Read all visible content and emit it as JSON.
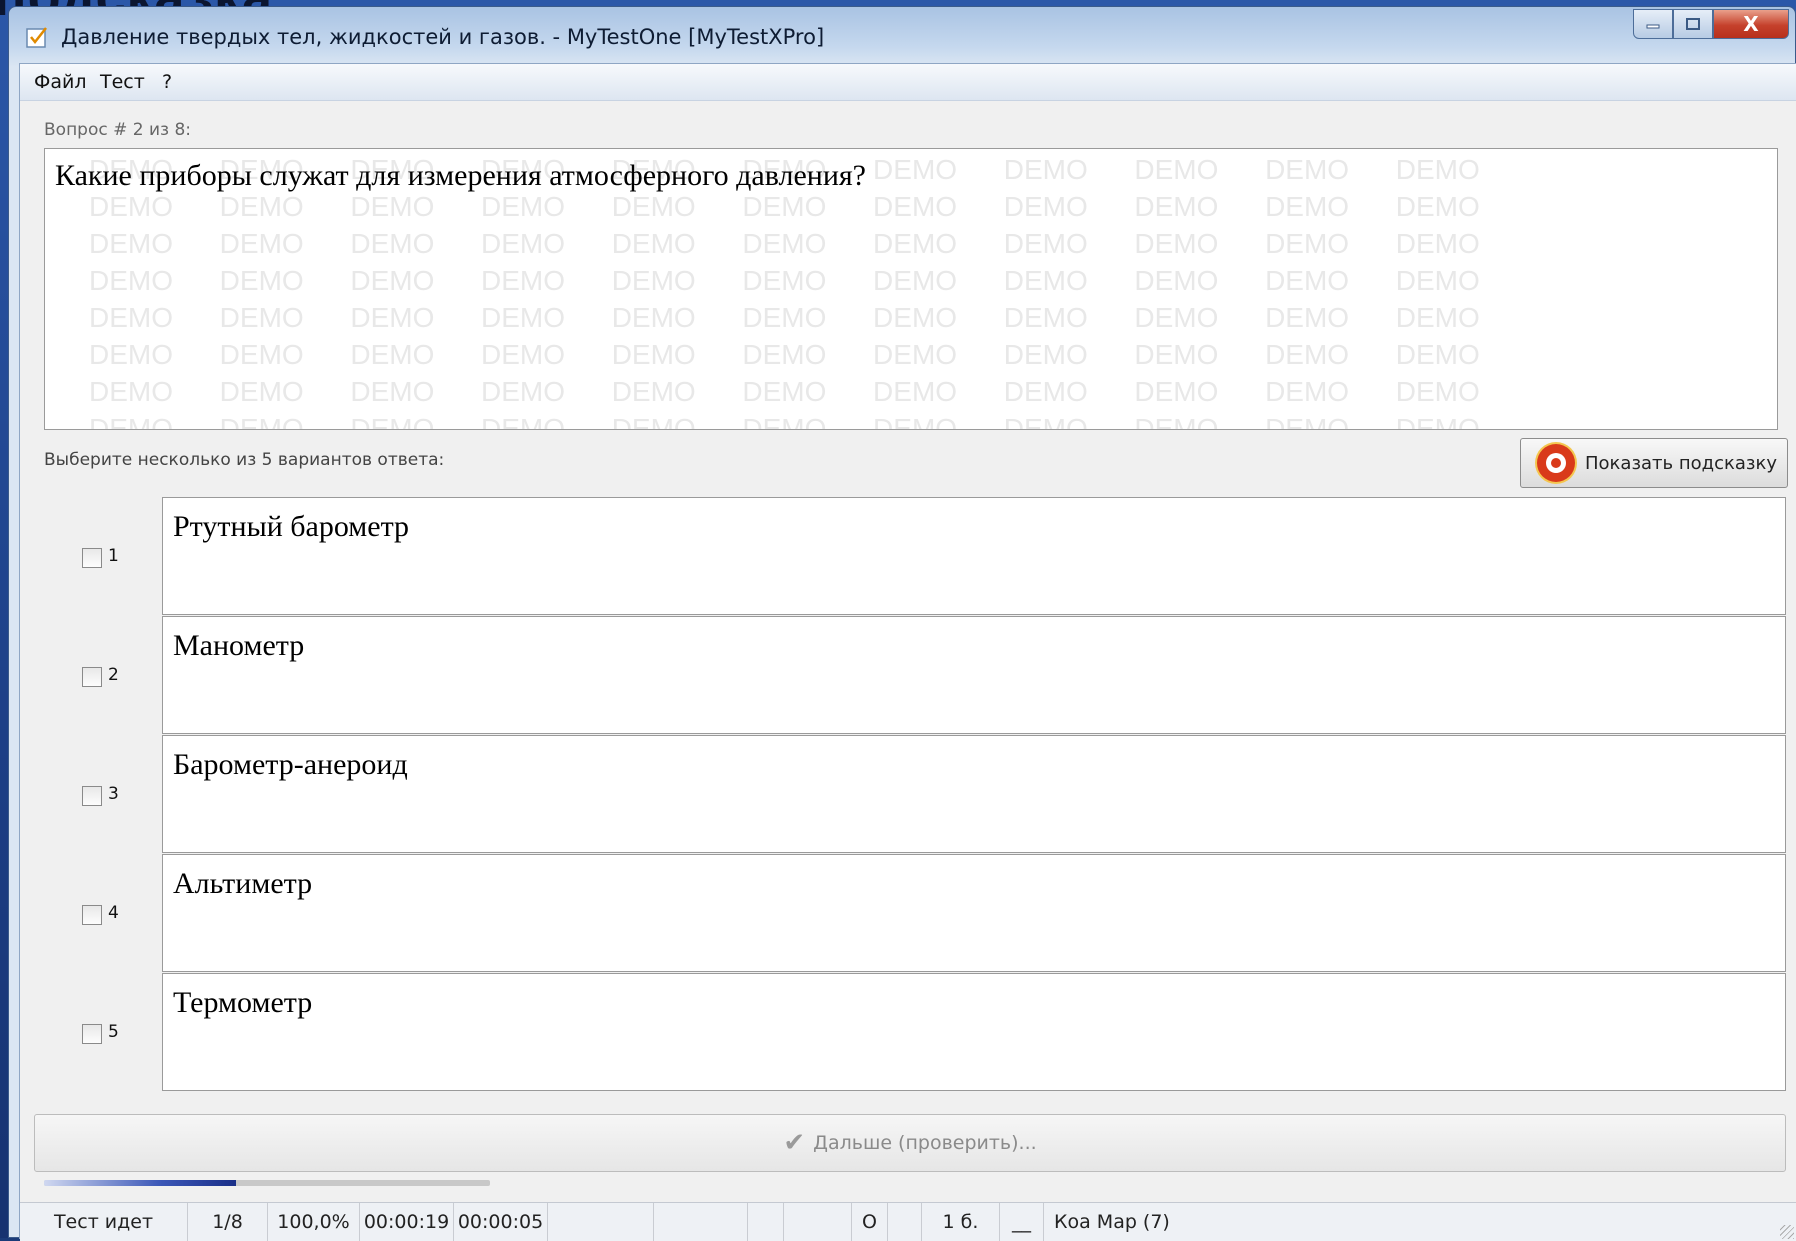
{
  "background": {
    "slide_title": "подсказка."
  },
  "window": {
    "title": "Давление твердых тел, жидкостей и газов. - MyTestOne [MyTestXPro]",
    "close_label": "X"
  },
  "menu": {
    "items": [
      "Файл",
      "Тест",
      "?"
    ]
  },
  "question": {
    "number_label": "Вопрос # 2 из 8:",
    "text": "Какие приборы служат для измерения атмосферного давления?",
    "watermark": "DEMO"
  },
  "answers": {
    "instruction": "Выберите несколько из 5 вариантов ответа:",
    "hint_button": "Показать подсказку",
    "options": [
      {
        "num": "1",
        "text": "Ртутный барометр",
        "checked": false
      },
      {
        "num": "2",
        "text": "Манометр",
        "checked": false
      },
      {
        "num": "3",
        "text": "Барометр-анероид",
        "checked": false
      },
      {
        "num": "4",
        "text": "Альтиметр",
        "checked": false
      },
      {
        "num": "5",
        "text": "Термометр",
        "checked": false
      }
    ]
  },
  "next_button": {
    "label": "Дальше (проверить)..."
  },
  "progress": {
    "fraction": 0.43
  },
  "status": {
    "state": "Тест идет",
    "position": "1/8",
    "percent": "100,0%",
    "time_total": "00:00:19",
    "time_question": "00:00:05",
    "cell_o": "O",
    "cell_score": "1 б.",
    "cell_blank": "__",
    "cell_label": "Коа Мар (7)"
  },
  "colors": {
    "accent": "#1a2f88",
    "title_bar": "#c5d8ee",
    "close": "#c5412c"
  }
}
